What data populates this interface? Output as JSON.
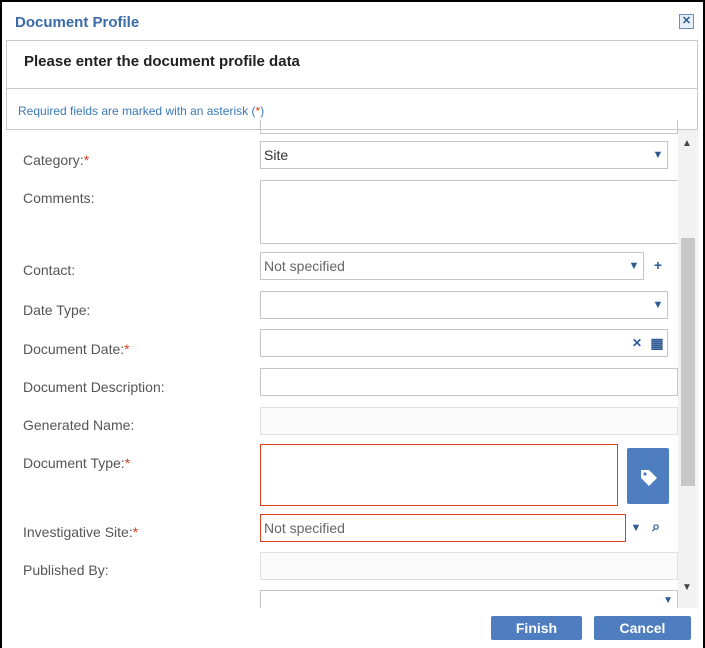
{
  "dialog": {
    "title": "Document Profile"
  },
  "header": {
    "text": "Please enter the document profile data"
  },
  "required_note": {
    "prefix": "Required fields are marked with an asterisk (",
    "star": "*",
    "suffix": ")"
  },
  "fields": {
    "category": {
      "label": "Category:",
      "value": "Site"
    },
    "comments": {
      "label": "Comments:"
    },
    "contact": {
      "label": "Contact:",
      "value": "Not specified"
    },
    "date_type": {
      "label": "Date Type:"
    },
    "document_date": {
      "label": "Document Date:"
    },
    "document_description": {
      "label": "Document Description:"
    },
    "generated_name": {
      "label": "Generated Name:"
    },
    "document_type": {
      "label": "Document Type:"
    },
    "investigative_site": {
      "label": "Investigative Site:",
      "value": "Not specified"
    },
    "published_by": {
      "label": "Published By:"
    }
  },
  "required_star": "*",
  "buttons": {
    "finish": "Finish",
    "cancel": "Cancel"
  }
}
